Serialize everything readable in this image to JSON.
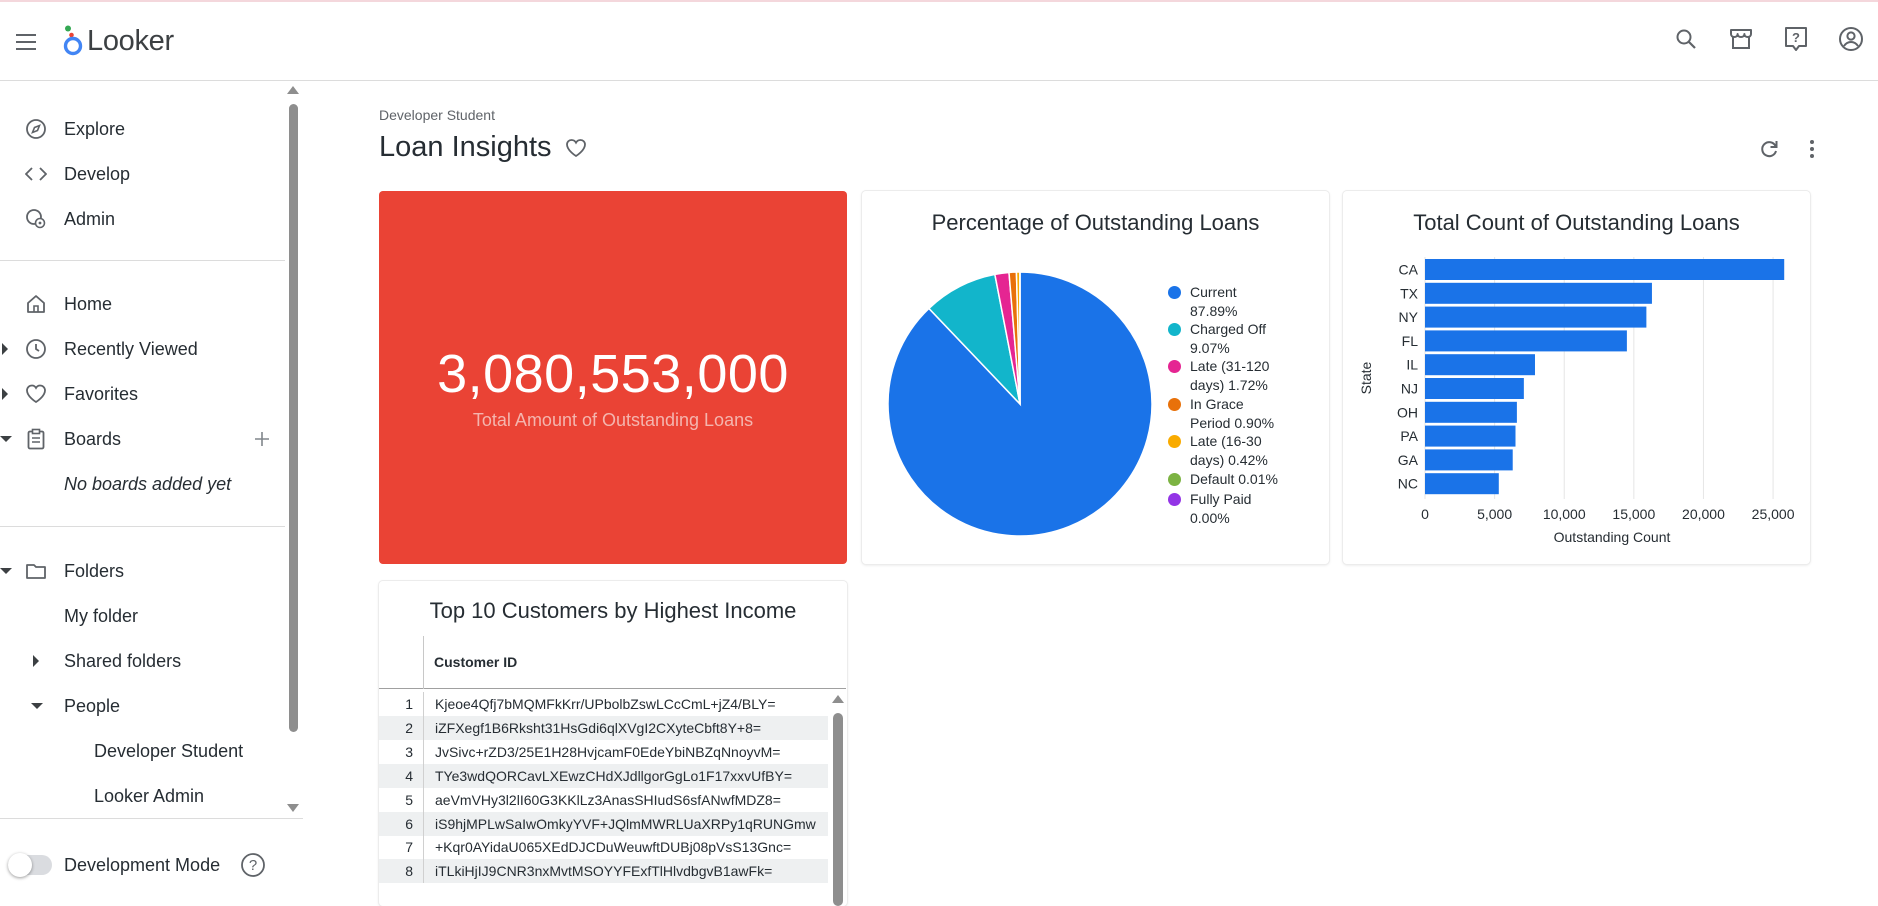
{
  "app": {
    "name": "Looker"
  },
  "header": {
    "icons": [
      "search-icon",
      "marketplace-icon",
      "help-icon",
      "account-icon"
    ]
  },
  "sidebar": {
    "explore": "Explore",
    "develop": "Develop",
    "admin": "Admin",
    "home": "Home",
    "recently_viewed": "Recently Viewed",
    "favorites": "Favorites",
    "boards": "Boards",
    "no_boards": "No boards added yet",
    "folders": "Folders",
    "my_folder": "My folder",
    "shared_folders": "Shared folders",
    "people": "People",
    "person_1": "Developer Student",
    "person_2": "Looker Admin",
    "dev_mode": "Development Mode",
    "dev_mode_enabled": false
  },
  "dashboard": {
    "breadcrumb": "Developer Student",
    "title": "Loan Insights"
  },
  "kpi": {
    "value": "3,080,553,000",
    "label": "Total Amount of Outstanding Loans",
    "background": "#ea4335"
  },
  "pie": {
    "title": "Percentage of Outstanding Loans",
    "legend": [
      {
        "l1": "Current",
        "l2": "87.89%",
        "color": "#1a73e8"
      },
      {
        "l1": "Charged Off",
        "l2": "9.07%",
        "color": "#12b5cb"
      },
      {
        "l1": "Late (31-120",
        "l2": "days) 1.72%",
        "color": "#e52592"
      },
      {
        "l1": "In Grace",
        "l2": "Period 0.90%",
        "color": "#e8710a"
      },
      {
        "l1": "Late (16-30",
        "l2": "days) 0.42%",
        "color": "#f9ab00"
      },
      {
        "l1": "Default 0.01%",
        "l2": "",
        "color": "#7cb342"
      },
      {
        "l1": "Fully Paid",
        "l2": "0.00%",
        "color": "#9334e6"
      }
    ]
  },
  "bar": {
    "title": "Total Count of Outstanding Loans",
    "ylabel": "State",
    "xlabel": "Outstanding Count",
    "ticks": [
      "0",
      "5,000",
      "10,000",
      "15,000",
      "20,000",
      "25,000"
    ]
  },
  "table": {
    "title": "Top 10 Customers by Highest Income",
    "column": "Customer ID",
    "rows": [
      {
        "n": "1",
        "id": "Kjeoe4Qfj7bMQMFkKrr/UPbolbZswLCcCmL+jZ4/BLY="
      },
      {
        "n": "2",
        "id": "iZFXegf1B6Rksht31HsGdi6qlXVgI2CXyteCbft8Y+8="
      },
      {
        "n": "3",
        "id": "JvSivc+rZD3/25E1H28HvjcamF0EdeYbiNBZqNnoyvM="
      },
      {
        "n": "4",
        "id": "TYe3wdQORCavLXEwzCHdXJdllgorGgLo1F17xxvUfBY="
      },
      {
        "n": "5",
        "id": "aeVmVHy3l2lI60G3KKlLz3AnasSHIudS6sfANwfMDZ8="
      },
      {
        "n": "6",
        "id": "iS9hjMPLwSaIwOmkyYVF+JQlmMWRLUaXRPy1qRUNGmw"
      },
      {
        "n": "7",
        "id": "+Kqr0AYidaU065XEdDJCDuWeuwftDUBj08pVsS13Gnc="
      },
      {
        "n": "8",
        "id": "iTLkiHjIJ9CNR3nxMvtMSOYYFExfTlHlvdbgvB1awFk="
      }
    ]
  },
  "chart_data": [
    {
      "type": "pie",
      "title": "Percentage of Outstanding Loans",
      "categories": [
        "Current",
        "Charged Off",
        "Late (31-120 days)",
        "In Grace Period",
        "Late (16-30 days)",
        "Default",
        "Fully Paid"
      ],
      "values": [
        87.89,
        9.07,
        1.72,
        0.9,
        0.42,
        0.01,
        0.0
      ],
      "colors": [
        "#1a73e8",
        "#12b5cb",
        "#e52592",
        "#e8710a",
        "#f9ab00",
        "#7cb342",
        "#9334e6"
      ],
      "legend": "right"
    },
    {
      "type": "bar",
      "orientation": "horizontal",
      "title": "Total Count of Outstanding Loans",
      "categories": [
        "CA",
        "TX",
        "NY",
        "FL",
        "IL",
        "NJ",
        "OH",
        "PA",
        "GA",
        "NC"
      ],
      "values": [
        25800,
        16300,
        15900,
        14500,
        7900,
        7100,
        6600,
        6500,
        6300,
        5300
      ],
      "xlabel": "Outstanding Count",
      "ylabel": "State",
      "xlim": [
        0,
        26000
      ],
      "color": "#1a73e8",
      "grid": true
    }
  ]
}
